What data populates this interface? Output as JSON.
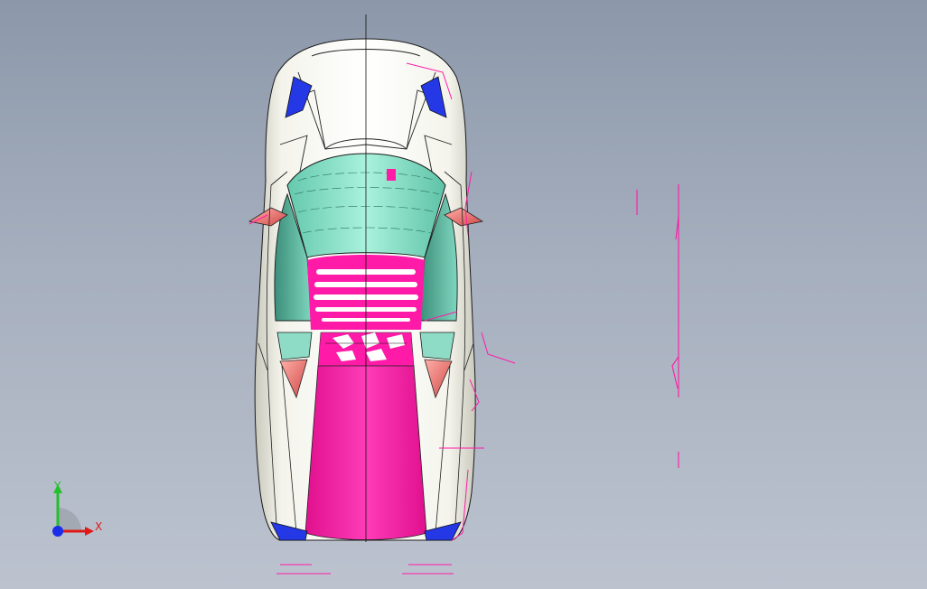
{
  "viewport": {
    "background_top": "#8c98aa",
    "background_bottom": "#bcc3cf",
    "model_view": "top"
  },
  "triad": {
    "y_label": "Y",
    "x_label": "X",
    "y_color": "#22c02a",
    "x_color": "#e01818",
    "z_color": "#1a2ee8"
  },
  "model": {
    "body_color": "#f6f6f0",
    "glass_color": "#7fe0c8",
    "accent_color": "#ff1aa8",
    "light_color": "#2030e0",
    "mirror_color": "#e87070"
  }
}
